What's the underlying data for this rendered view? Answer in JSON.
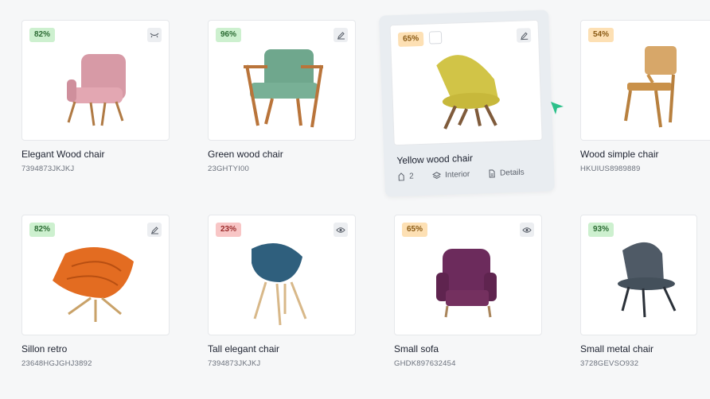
{
  "products": [
    {
      "name": "Elegant Wood chair",
      "sku": "7394873JKJKJ",
      "score": "82%",
      "badge": "green",
      "action": "hide-icon"
    },
    {
      "name": "Green wood chair",
      "sku": "23GHTYI00",
      "score": "96%",
      "badge": "green",
      "action": "edit-icon"
    },
    {
      "name": "Yellow wood chair",
      "score": "65%",
      "badge": "orange",
      "action": "edit-icon",
      "selected": true,
      "meta": {
        "count": "2",
        "category": "Interior",
        "details": "Details"
      }
    },
    {
      "name": "Wood simple chair",
      "sku": "HKUIUS8989889",
      "score": "54%",
      "badge": "orange",
      "action": "none"
    },
    {
      "name": "Sillon retro",
      "sku": "23648HGJGHJ3892",
      "score": "82%",
      "badge": "green",
      "action": "edit-icon"
    },
    {
      "name": "Tall elegant chair",
      "sku": "7394873JKJKJ",
      "score": "23%",
      "badge": "red",
      "action": "eye-icon"
    },
    {
      "name": "Small sofa",
      "sku": "GHDK897632454",
      "score": "65%",
      "badge": "orange",
      "action": "eye-icon"
    },
    {
      "name": "Small metal chair",
      "sku": "3728GEVSO932",
      "score": "93%",
      "badge": "green",
      "action": "none"
    }
  ],
  "colors": {
    "accent_cursor": "#2cc08a",
    "badge_green": "#cdf0cf",
    "badge_orange": "#fde0b4",
    "badge_red": "#f8c6c6"
  }
}
